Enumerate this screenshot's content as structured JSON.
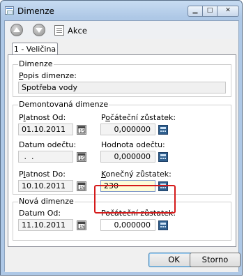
{
  "window": {
    "title": "Dimenze"
  },
  "toolbar": {
    "action_label": "Akce"
  },
  "tabs": [
    {
      "label": "1 - Veličina"
    }
  ],
  "dimension": {
    "group_title": "Dimenze",
    "description_label_prefix": "P",
    "description_label_rest": "opis dimenze:",
    "description_value": "Spotřeba vody"
  },
  "removed": {
    "group_title": "Demontovaná dimenze",
    "valid_from_label_a": "P",
    "valid_from_label_u": "l",
    "valid_from_label_b": "atnost Od:",
    "valid_from_value": "01.10.2011",
    "initial_state_label_a": "P",
    "initial_state_label_u": "o",
    "initial_state_label_b": "čáteční zůstatek:",
    "initial_state_value": "0,000000",
    "reading_date_label": "Datum odečtu:",
    "reading_date_value": " .  .",
    "reading_value_label": "Hodnota odečtu:",
    "reading_value_value": "0,000000",
    "valid_to_label_a": "P",
    "valid_to_label_u": "l",
    "valid_to_label_b": "atnost Do:",
    "valid_to_value": "10.10.2011",
    "final_state_label_u": "K",
    "final_state_label_b": "onečný zůstatek:",
    "final_state_value": "230"
  },
  "new_dimension": {
    "group_title": "Nová dimenze",
    "date_from_label": "Datum Od:",
    "date_from_value": "11.10.2011",
    "initial_state_label": "Počáteční zůstatek:",
    "initial_state_value": "0,000000"
  },
  "buttons": {
    "ok": "OK",
    "cancel": "Storno"
  }
}
